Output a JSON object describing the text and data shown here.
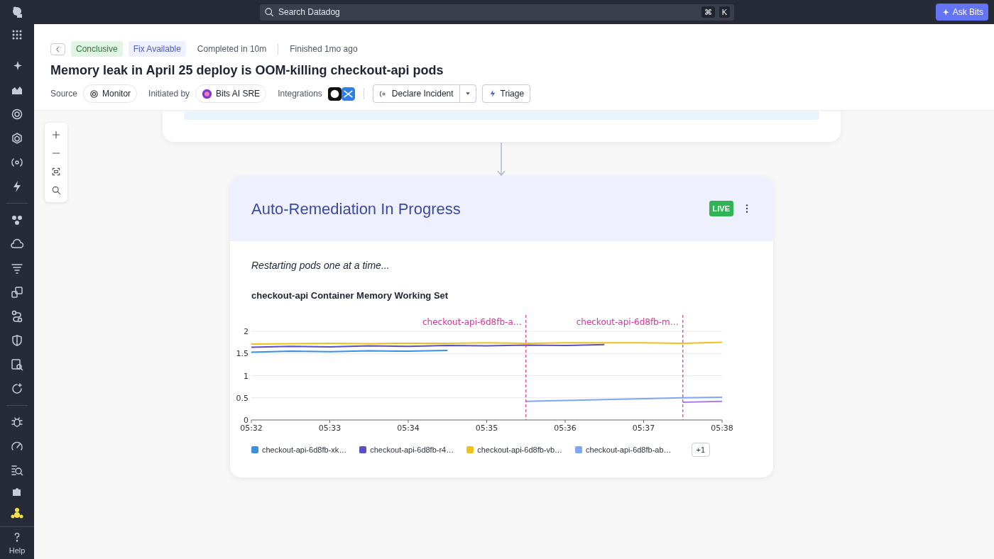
{
  "topbar": {
    "search_placeholder": "Search Datadog",
    "shortcut_keys": [
      "⌘",
      "K"
    ],
    "ask_button": "Ask Bits"
  },
  "sidebar": {
    "help_label": "Help"
  },
  "header": {
    "status_tags": [
      {
        "label": "Conclusive",
        "kind": "success"
      },
      {
        "label": "Fix Available",
        "kind": "info"
      }
    ],
    "completed": "Completed in 10m",
    "finished": "Finished 1mo ago",
    "title": "Memory leak in April 25 deploy is OOM-killing checkout-api pods",
    "source_label": "Source",
    "source": "Monitor",
    "initiated_label": "Initiated by",
    "initiator": "Bits AI SRE",
    "integrations_label": "Integrations",
    "actions": [
      {
        "label": "Declare Incident",
        "kind": "split"
      },
      {
        "label": "Triage",
        "kind": "plain"
      }
    ]
  },
  "card": {
    "title": "Auto-Remediation In Progress",
    "badge": "LIVE",
    "status_text": "Restarting pods one at a time...",
    "chart_title": "checkout-api Container Memory Working Set",
    "chart_data": {
      "type": "line",
      "categories": [
        "05:32",
        null,
        "05:33",
        null,
        "05:34",
        null,
        "05:35",
        null,
        "05:36",
        null,
        "05:37",
        null,
        "05:38"
      ],
      "series": [
        {
          "name": "checkout-api-6d8fb-xk…",
          "color": "#3b8fe0",
          "values": [
            1.53,
            1.55,
            1.54,
            1.56,
            1.55,
            1.57,
            null,
            null,
            null,
            null,
            null,
            null,
            null
          ]
        },
        {
          "name": "checkout-api-6d8fb-r4…",
          "color": "#5a4fc4",
          "values": [
            1.64,
            1.66,
            1.65,
            1.67,
            1.66,
            1.68,
            1.67,
            1.69,
            1.68,
            1.7,
            null,
            null,
            null
          ]
        },
        {
          "name": "checkout-api-6d8fb-vb…",
          "color": "#f0c11c",
          "values": [
            1.71,
            1.72,
            1.73,
            1.72,
            1.73,
            1.73,
            1.74,
            1.73,
            1.74,
            1.74,
            1.74,
            1.73,
            1.75
          ]
        },
        {
          "name": "checkout-api-6d8fb-ab…",
          "color": "#7ea6f7",
          "values": [
            null,
            null,
            null,
            null,
            null,
            null,
            null,
            0.42,
            0.44,
            0.46,
            0.48,
            0.5,
            0.51
          ]
        },
        {
          "color": "#a77cf0",
          "values": [
            null,
            null,
            null,
            null,
            null,
            null,
            null,
            null,
            null,
            null,
            null,
            0.4,
            0.42
          ]
        }
      ],
      "ylim": [
        0,
        2
      ],
      "yticks": [
        0,
        0.5,
        1,
        1.5,
        2
      ],
      "grid": true,
      "annotations": [
        "checkout-api-6d8fb-a…",
        "checkout-api-6d8fb-m…"
      ]
    },
    "legend_more": "+1"
  }
}
